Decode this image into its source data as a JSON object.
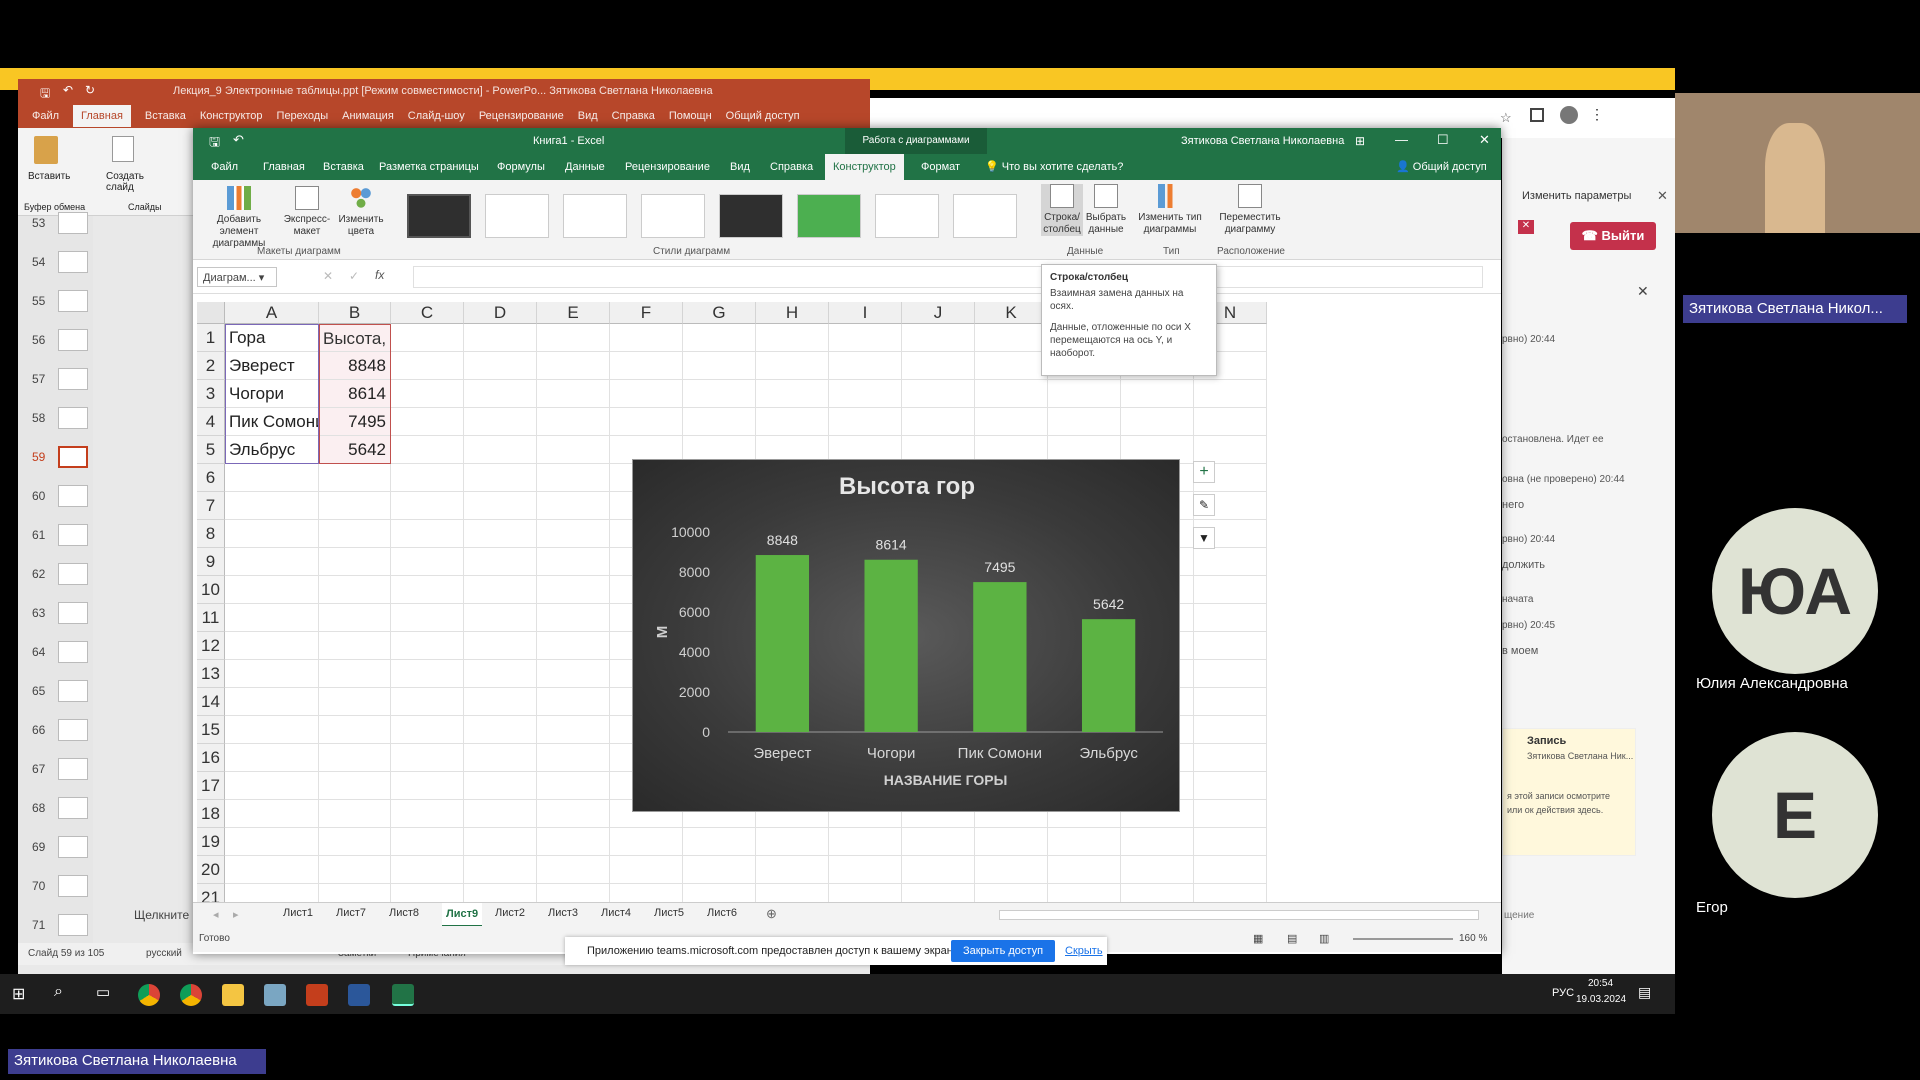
{
  "ppt": {
    "title": "Лекция_9 Электронные таблицы.ppt [Режим совместимости] - PowerPo...   Зятикова Светлана Николаевна",
    "tabs": [
      "Файл",
      "Главная",
      "Вставка",
      "Конструктор",
      "Переходы",
      "Анимация",
      "Слайд-шоу",
      "Рецензирование",
      "Вид",
      "Справка",
      "Помощн",
      "Общий доступ"
    ],
    "ribbon": {
      "paste": "Вставить",
      "new_slide": "Создать слайд",
      "group_clipboard": "Буфер обмена",
      "group_slides": "Слайды"
    },
    "slides": [
      "53",
      "54",
      "55",
      "56",
      "57",
      "58",
      "59",
      "60",
      "61",
      "62",
      "63",
      "64",
      "65",
      "66",
      "67",
      "68",
      "69",
      "70",
      "71"
    ],
    "selected_slide": "59",
    "status_slide": "Слайд 59 из 105",
    "status_lang": "русский",
    "status_notes": "Заметки",
    "status_comments": "Примечания",
    "click_hint": "Щелкните"
  },
  "excel": {
    "title": "Книга1 - Excel",
    "context_title": "Работа с диаграммами",
    "user": "Зятикова Светлана Николаевна",
    "tabs": [
      "Файл",
      "Главная",
      "Вставка",
      "Разметка страницы",
      "Формулы",
      "Данные",
      "Рецензирование",
      "Вид",
      "Справка",
      "Конструктор",
      "Формат"
    ],
    "active_tab": "Конструктор",
    "tell_me": "Что вы хотите сделать?",
    "share": "Общий доступ",
    "ribbon": {
      "add_element": "Добавить элемент диаграммы",
      "quick_layout": "Экспресс-макет",
      "change_colors": "Изменить цвета",
      "group_layouts": "Макеты диаграмм",
      "group_styles": "Стили диаграмм",
      "switch_row_col": "Строка/ столбец",
      "select_data": "Выбрать данные",
      "group_data": "Данные",
      "change_type": "Изменить тип диаграммы",
      "group_type": "Тип",
      "move_chart": "Переместить диаграмму",
      "group_location": "Расположение"
    },
    "namebox": "Диаграм...",
    "fx": "fx",
    "columns": [
      "A",
      "B",
      "C",
      "D",
      "E",
      "F",
      "G",
      "H",
      "I",
      "J",
      "K",
      "L",
      "M",
      "N"
    ],
    "rows": [
      "1",
      "2",
      "3",
      "4",
      "5",
      "6",
      "7",
      "8",
      "9",
      "10",
      "11",
      "12",
      "13",
      "14",
      "15",
      "16",
      "17",
      "18",
      "19",
      "20",
      "21"
    ],
    "cells": {
      "A1": "Гора",
      "B1": "Высота, м",
      "A2": "Эверест",
      "B2": "8848",
      "A3": "Чогори",
      "B3": "8614",
      "A4": "Пик Сомони",
      "B4": "7495",
      "A5": "Эльбрус",
      "B5": "5642"
    },
    "sheets": [
      "Лист1",
      "Лист7",
      "Лист8",
      "Лист9",
      "Лист2",
      "Лист3",
      "Лист4",
      "Лист5",
      "Лист6"
    ],
    "active_sheet": "Лист9",
    "status_ready": "Готово",
    "zoom": "160 %",
    "tooltip": {
      "title": "Строка/столбец",
      "line1": "Взаимная замена данных на осях.",
      "line2": "Данные, отложенные по оси X перемещаются на ось Y, и наоборот."
    }
  },
  "chart_data": {
    "type": "bar",
    "title": "Высота гор",
    "categories": [
      "Эверест",
      "Чогори",
      "Пик Сомони",
      "Эльбрус"
    ],
    "values": [
      8848,
      8614,
      7495,
      5642
    ],
    "xlabel": "НАЗВАНИЕ ГОРЫ",
    "ylabel": "М",
    "ylim": [
      0,
      10000
    ],
    "yticks": [
      "0",
      "2000",
      "4000",
      "6000",
      "8000",
      "10000"
    ],
    "bar_color": "#5cb343",
    "grid": false
  },
  "sharebar": {
    "text": "Приложению teams.microsoft.com предоставлен доступ к вашему экрану.",
    "stop": "Закрыть доступ",
    "hide": "Скрыть"
  },
  "teams": {
    "change_params": "Изменить параметры",
    "leave": "Выйти",
    "chat": [
      "рвно) 20:44",
      "остановлена. Идет ее",
      "овна (не проверено) 20:44",
      "него",
      "рвно) 20:44",
      "должить",
      "начата",
      "рвно) 20:45",
      "в моем"
    ],
    "record_title": "Запись",
    "record_user": "Зятикова Светлана Ник...",
    "record_note": "я этой записи осмотрите или ок действия здесь.",
    "message_placeholder": "щение"
  },
  "participants": {
    "presenter_chip": "Зятикова Светлана Никол...",
    "p1_initials": "ЮА",
    "p1_name": "Юлия Александровна",
    "p2_initials": "Е",
    "p2_name": "Егор",
    "bottom_name": "Зятикова Светлана Николаевна"
  },
  "taskbar": {
    "lang": "РУС",
    "time": "20:54",
    "date": "19.03.2024"
  }
}
